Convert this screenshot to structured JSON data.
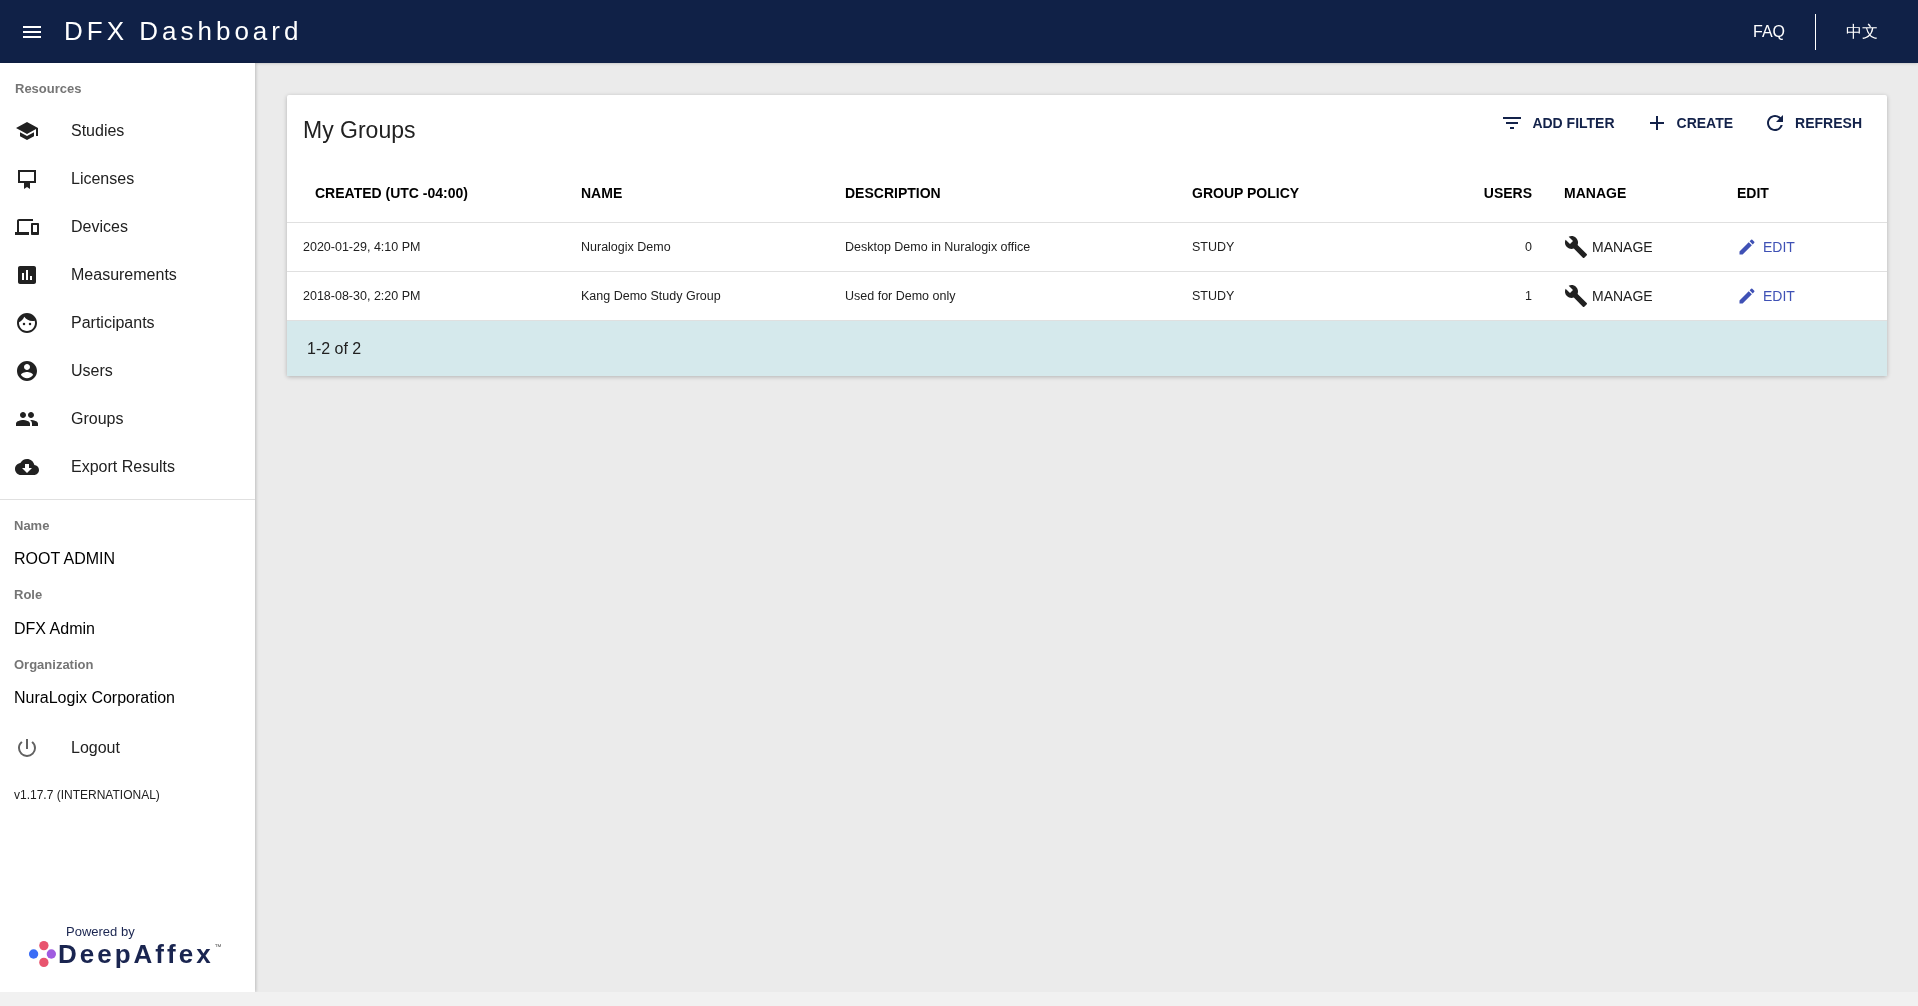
{
  "app_bar": {
    "title": "DFX Dashboard",
    "links": [
      "FAQ",
      "中文"
    ]
  },
  "sidebar": {
    "section_label": "Resources",
    "items": [
      {
        "label": "Studies",
        "kind": "studies"
      },
      {
        "label": "Licenses",
        "kind": "licenses"
      },
      {
        "label": "Devices",
        "kind": "devices"
      },
      {
        "label": "Measurements",
        "kind": "measurements"
      },
      {
        "label": "Participants",
        "kind": "participants"
      },
      {
        "label": "Users",
        "kind": "users"
      },
      {
        "label": "Groups",
        "kind": "groups"
      },
      {
        "label": "Export Results",
        "kind": "export"
      }
    ],
    "profile": [
      {
        "label": "Name",
        "value": "ROOT ADMIN"
      },
      {
        "label": "Role",
        "value": "DFX Admin"
      },
      {
        "label": "Organization",
        "value": "NuraLogix Corporation"
      }
    ],
    "logout": "Logout",
    "version": "v1.17.7 (INTERNATIONAL)",
    "footer": {
      "powered_by": "Powered by",
      "brand": "DeepAffex",
      "trademark": "™"
    }
  },
  "card": {
    "title": "My Groups",
    "actions": [
      {
        "label": "ADD FILTER",
        "kind": "filter"
      },
      {
        "label": "CREATE",
        "kind": "add"
      },
      {
        "label": "REFRESH",
        "kind": "refresh"
      }
    ],
    "table": {
      "columns": [
        "CREATED (UTC -04:00)",
        "NAME",
        "DESCRIPTION",
        "GROUP POLICY",
        "USERS",
        "MANAGE",
        "EDIT"
      ],
      "rows": [
        {
          "created": "2020-01-29, 4:10 PM",
          "name": "Nuralogix Demo",
          "description": "Desktop Demo in Nuralogix office",
          "policy": "STUDY",
          "users": "0",
          "manage": "MANAGE",
          "edit": "EDIT"
        },
        {
          "created": "2018-08-30, 2:20 PM",
          "name": "Kang Demo Study Group",
          "description": "Used for Demo only",
          "policy": "STUDY",
          "users": "1",
          "manage": "MANAGE",
          "edit": "EDIT"
        }
      ]
    },
    "pagination": "1-2 of 2"
  }
}
